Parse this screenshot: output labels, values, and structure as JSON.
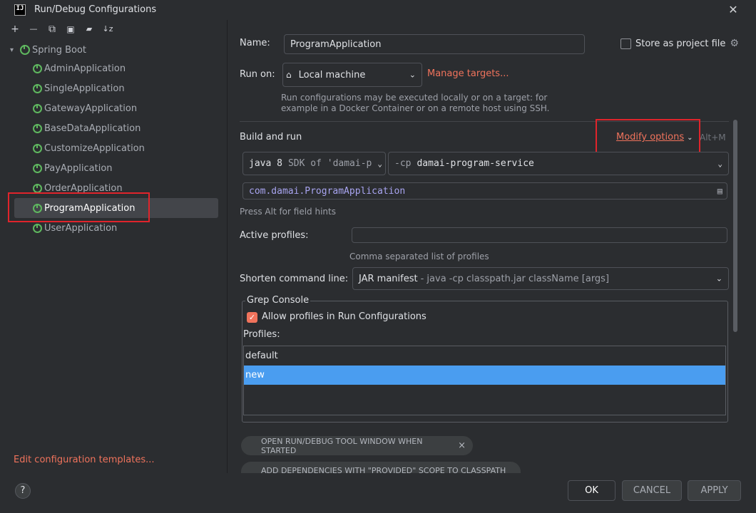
{
  "window": {
    "title": "Run/Debug Configurations",
    "close_glyph": "✕",
    "logo_text": "IJ"
  },
  "toolbar": {
    "icons": [
      "add-icon",
      "remove-icon",
      "copy-icon",
      "save-icon",
      "new-folder-icon",
      "sort-icon"
    ],
    "add_glyph": "+",
    "remove_glyph": "—",
    "copy_glyph": "⧉",
    "save_glyph": "▣",
    "folder_glyph": "▰",
    "sort_glyph": "↓z"
  },
  "tree": {
    "root_label": "Spring Boot",
    "items": [
      {
        "label": "AdminApplication"
      },
      {
        "label": "SingleApplication"
      },
      {
        "label": "GatewayApplication"
      },
      {
        "label": "BaseDataApplication"
      },
      {
        "label": "CustomizeApplication"
      },
      {
        "label": "PayApplication"
      },
      {
        "label": "OrderApplication"
      },
      {
        "label": "ProgramApplication",
        "selected": true
      },
      {
        "label": "UserApplication"
      }
    ]
  },
  "edit_templates": "Edit configuration templates...",
  "help_glyph": "?",
  "form": {
    "name_label": "Name:",
    "name_value": "ProgramApplication",
    "store_label": "Store as project file",
    "run_on_label": "Run on:",
    "run_on_value": "Local machine",
    "manage_targets": "Manage targets...",
    "run_on_hint_1": "Run configurations may be executed locally or on a target: for",
    "run_on_hint_2": "example in a Docker Container or on a remote host using SSH.",
    "section_title": "Build and run",
    "modify_options": "Modify options",
    "modify_shortcut": "Alt+M",
    "jdk_value": "java 8",
    "jdk_detail": "SDK of 'damai-p",
    "cp_prefix": "-cp",
    "cp_value": "damai-program-service",
    "main_class": "com.damai.ProgramApplication",
    "field_hint": "Press Alt for field hints",
    "active_profiles_label": "Active profiles:",
    "active_profiles_value": "",
    "active_profiles_hint": "Comma separated list of profiles",
    "shorten_label": "Shorten command line:",
    "shorten_value": "JAR manifest",
    "shorten_detail": "- java -cp classpath.jar className [args]"
  },
  "grep_console": {
    "title": "Grep Console",
    "allow_profiles_label": "Allow profiles in Run Configurations",
    "allow_profiles_checked": true,
    "profiles_label": "Profiles:",
    "profiles": [
      {
        "name": "default",
        "selected": false
      },
      {
        "name": "new",
        "selected": true
      }
    ]
  },
  "chips": [
    {
      "label": "OPEN RUN/DEBUG TOOL WINDOW WHEN STARTED"
    },
    {
      "label": "ADD DEPENDENCIES WITH \"PROVIDED\" SCOPE TO CLASSPATH"
    }
  ],
  "buttons": {
    "ok": "OK",
    "cancel": "CANCEL",
    "apply": "APPLY"
  },
  "colors": {
    "accent": "#f0735c",
    "selection": "#4a9df0",
    "highlight_box": "#e0242b",
    "spring_icon": "#5fb85f"
  }
}
